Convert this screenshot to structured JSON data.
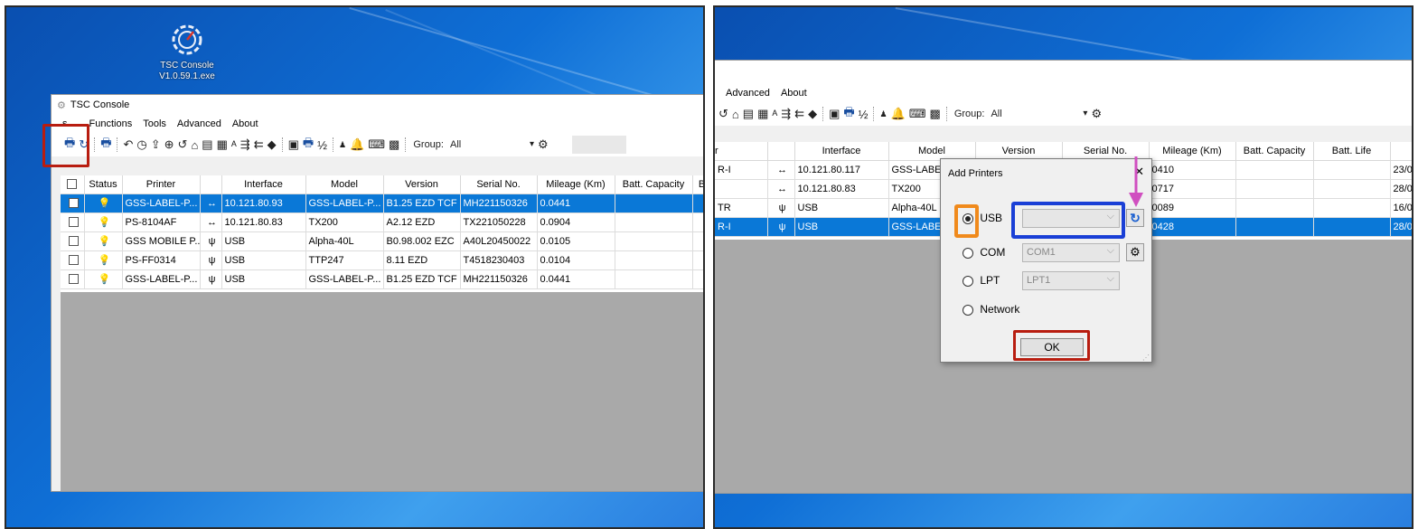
{
  "desktop_icon": {
    "label_line1": "TSC Console",
    "label_line2": "V1.0.59.1.exe"
  },
  "app": {
    "title": "TSC Console"
  },
  "menu_left": [
    "s",
    "Functions",
    "Tools",
    "Advanced",
    "About"
  ],
  "menu_right": [
    "Advanced",
    "About"
  ],
  "toolbar": {
    "group_label": "Group:",
    "group_value": "All"
  },
  "columns_left": [
    "",
    "Status",
    "Printer",
    "",
    "Interface",
    "Model",
    "Version",
    "Serial No.",
    "Mileage (Km)",
    "Batt. Capacity",
    "B"
  ],
  "rows_left": [
    {
      "printer": "GSS-LABEL-P...",
      "iface_icon": "↔",
      "interface": "10.121.80.93",
      "model": "GSS-LABEL-P...",
      "version": "B1.25 EZD TCF",
      "serial": "MH221150326",
      "mileage": "0.0441",
      "status": "gray",
      "selected": true
    },
    {
      "printer": "PS-8104AF",
      "iface_icon": "↔",
      "interface": "10.121.80.83",
      "model": "TX200",
      "version": "A2.12 EZD",
      "serial": "TX221050228",
      "mileage": "0.0904",
      "status": "green",
      "selected": false
    },
    {
      "printer": "GSS MOBILE P...",
      "iface_icon": "ψ",
      "interface": "USB",
      "model": "Alpha-40L",
      "version": "B0.98.002 EZC",
      "serial": "A40L20450022",
      "mileage": "0.0105",
      "status": "gray",
      "selected": false
    },
    {
      "printer": "PS-FF0314",
      "iface_icon": "ψ",
      "interface": "USB",
      "model": "TTP247",
      "version": "8.11 EZD",
      "serial": "T4518230403",
      "mileage": "0.0104",
      "status": "gray",
      "selected": false
    },
    {
      "printer": "GSS-LABEL-P...",
      "iface_icon": "ψ",
      "interface": "USB",
      "model": "GSS-LABEL-P...",
      "version": "B1.25 EZD TCF",
      "serial": "MH221150326",
      "mileage": "0.0441",
      "status": "gray",
      "selected": false
    }
  ],
  "columns_right": [
    "r",
    "",
    "Interface",
    "Model",
    "Version",
    "Serial No.",
    "Mileage (Km)",
    "Batt. Capacity",
    "Batt. Life",
    ""
  ],
  "rows_right": [
    {
      "c0": "R-I",
      "iface_icon": "↔",
      "interface": "10.121.80.117",
      "model": "GSS-LABE",
      "mileage": "0410",
      "extra": "23/0",
      "selected": false
    },
    {
      "c0": "",
      "iface_icon": "↔",
      "interface": "10.121.80.83",
      "model": "TX200",
      "mileage": "0717",
      "extra": "28/0",
      "selected": false
    },
    {
      "c0": "TR",
      "iface_icon": "ψ",
      "interface": "USB",
      "model": "Alpha-40L",
      "mileage": "0089",
      "extra": "16/0",
      "selected": false
    },
    {
      "c0": "R-I",
      "iface_icon": "ψ",
      "interface": "USB",
      "model": "GSS-LABE",
      "mileage": "0428",
      "extra": "28/0",
      "selected": true
    }
  ],
  "dialog": {
    "title": "Add Printers",
    "close": "✕",
    "usb_label": "USB",
    "com_label": "COM",
    "com_value": "COM1",
    "lpt_label": "LPT",
    "lpt_value": "LPT1",
    "network_label": "Network",
    "ok_label": "OK",
    "refresh_icon": "↻"
  },
  "colors": {
    "highlight_red": "#b81d10",
    "highlight_orange": "#f08a1c",
    "highlight_blue": "#1a3fd6",
    "arrow_pink": "#d04fc0",
    "selection": "#0a78d7"
  }
}
